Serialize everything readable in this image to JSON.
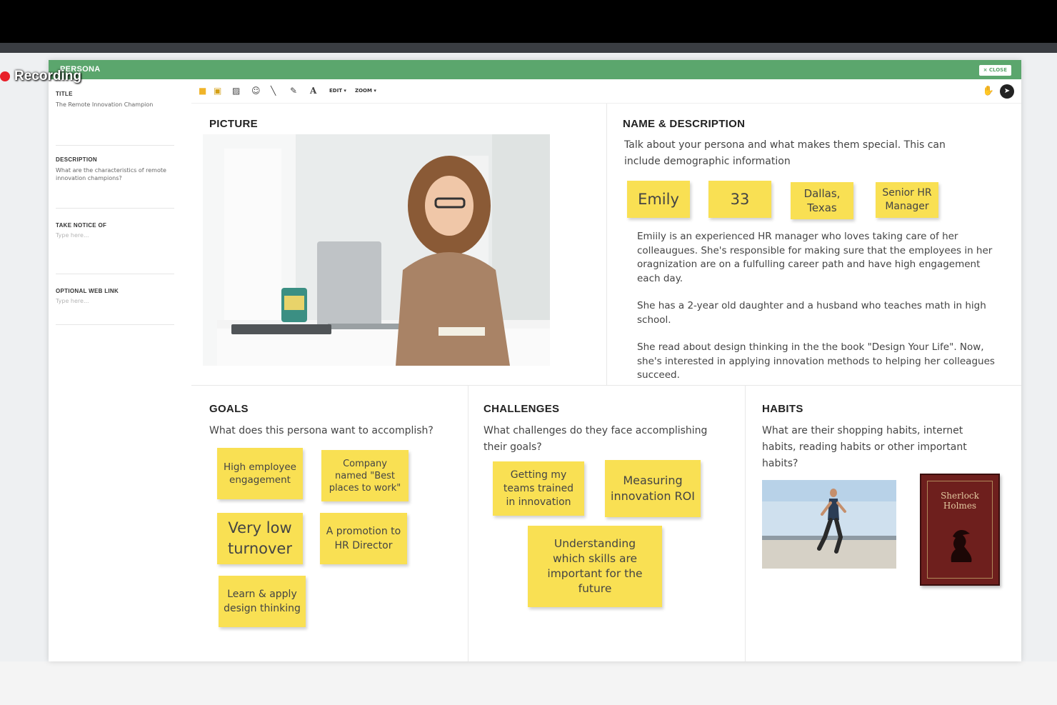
{
  "recording": {
    "label": "Recording"
  },
  "modal": {
    "title": "PERSONA",
    "close_label": "× CLOSE"
  },
  "sidebar": {
    "title_label": "TITLE",
    "title_value": "The Remote Innovation Champion",
    "description_label": "DESCRIPTION",
    "description_value": "What are the characteristics of remote innovation champions?",
    "take_notice_label": "TAKE NOTICE OF",
    "take_notice_placeholder": "Type here...",
    "web_link_label": "OPTIONAL WEB LINK",
    "web_link_placeholder": "Type here..."
  },
  "toolbar": {
    "tools": [
      "sticky-note-icon",
      "image-cluster-icon",
      "image-icon",
      "emoji-icon",
      "line-icon",
      "pen-icon",
      "text-icon"
    ],
    "edit_label": "EDIT ▾",
    "zoom_label": "ZOOM ▾"
  },
  "picture": {
    "title": "PICTURE"
  },
  "name_desc": {
    "title": "NAME & DESCRIPTION",
    "prompt": "Talk about your persona and what makes them special. This can include demographic information",
    "notes": [
      "Emily",
      "33",
      "Dallas, Texas",
      "Senior HR Manager"
    ],
    "paragraphs": [
      "Emiily is an experienced HR manager who loves taking care of her colleaugues. She's responsible for making sure that the employees in her oragnization are on a fulfulling career path and have high engagement each day.",
      "She has a 2-year old daughter and a husband who teaches math in high school.",
      "She read about design thinking in the the book \"Design Your Life\". Now, she's interested in applying innovation methods to helping her colleagues succeed."
    ]
  },
  "goals": {
    "title": "GOALS",
    "prompt": "What does this persona want to accomplish?",
    "notes": [
      "High employee engagement",
      "Company named \"Best places to work\"",
      "Very low turnover",
      "A promotion to HR Director",
      "Learn & apply design thinking"
    ]
  },
  "challenges": {
    "title": "CHALLENGES",
    "prompt": "What challenges do they face accomplishing their goals?",
    "notes": [
      "Getting my teams trained in innovation",
      "Measuring innovation ROI",
      "Understanding which skills are important for the future"
    ]
  },
  "habits": {
    "title": "HABITS",
    "prompt": "What are their shopping habits, internet habits, reading habits or other important habits?",
    "book_title": "Sherlock Holmes"
  },
  "colors": {
    "header_green": "#5ba66d",
    "sticky_yellow": "#f9e053"
  }
}
